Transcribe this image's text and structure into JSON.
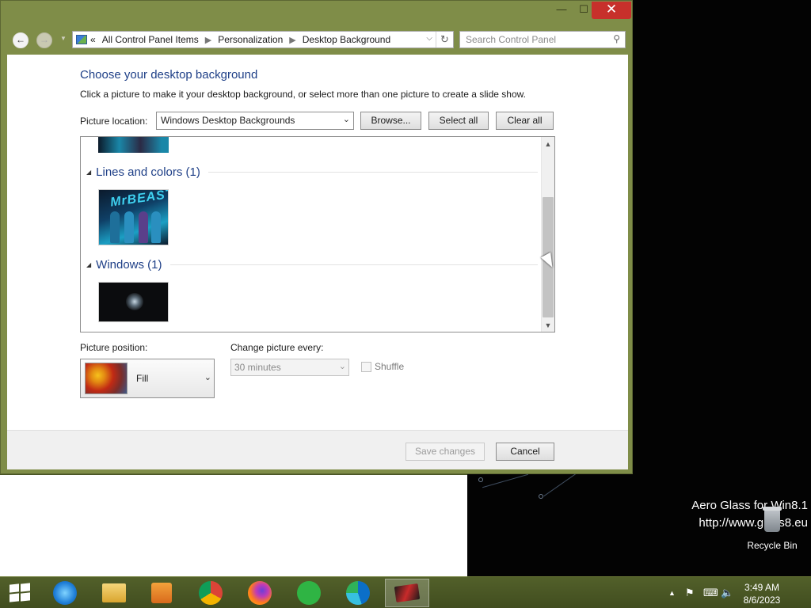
{
  "window": {
    "address": {
      "overflow": "«",
      "crumbs": [
        "All Control Panel Items",
        "Personalization",
        "Desktop Background"
      ]
    },
    "search_placeholder": "Search Control Panel"
  },
  "page": {
    "heading": "Choose your desktop background",
    "instruction": "Click a picture to make it your desktop background, or select more than one picture to create a slide show.",
    "picture_location_label": "Picture location:",
    "picture_location_value": "Windows Desktop Backgrounds",
    "browse_label": "Browse...",
    "select_all_label": "Select all",
    "clear_all_label": "Clear all",
    "groups": [
      {
        "title": "Lines and colors (1)"
      },
      {
        "title": "Windows (1)"
      }
    ],
    "thumb_logo_text": "MrBEAST",
    "picture_position_label": "Picture position:",
    "picture_position_value": "Fill",
    "change_every_label": "Change picture every:",
    "change_every_value": "30 minutes",
    "shuffle_label": "Shuffle",
    "save_label": "Save changes",
    "cancel_label": "Cancel"
  },
  "desktop": {
    "watermark_line1": "Aero Glass for Win8.1",
    "watermark_line2": "http://www.glass8.eu",
    "recycle_bin_label": "Recycle Bin"
  },
  "taskbar": {
    "apps": [
      "internet-explorer-icon",
      "file-explorer-icon",
      "media-player-icon",
      "chrome-icon",
      "firefox-icon",
      "green-notes-icon",
      "edge-icon",
      "personalization-icon"
    ],
    "time": "3:49 AM",
    "date": "8/6/2023"
  },
  "colors": {
    "frame": "#7f8d48",
    "heading": "#1e3f87",
    "close": "#c7302b"
  }
}
